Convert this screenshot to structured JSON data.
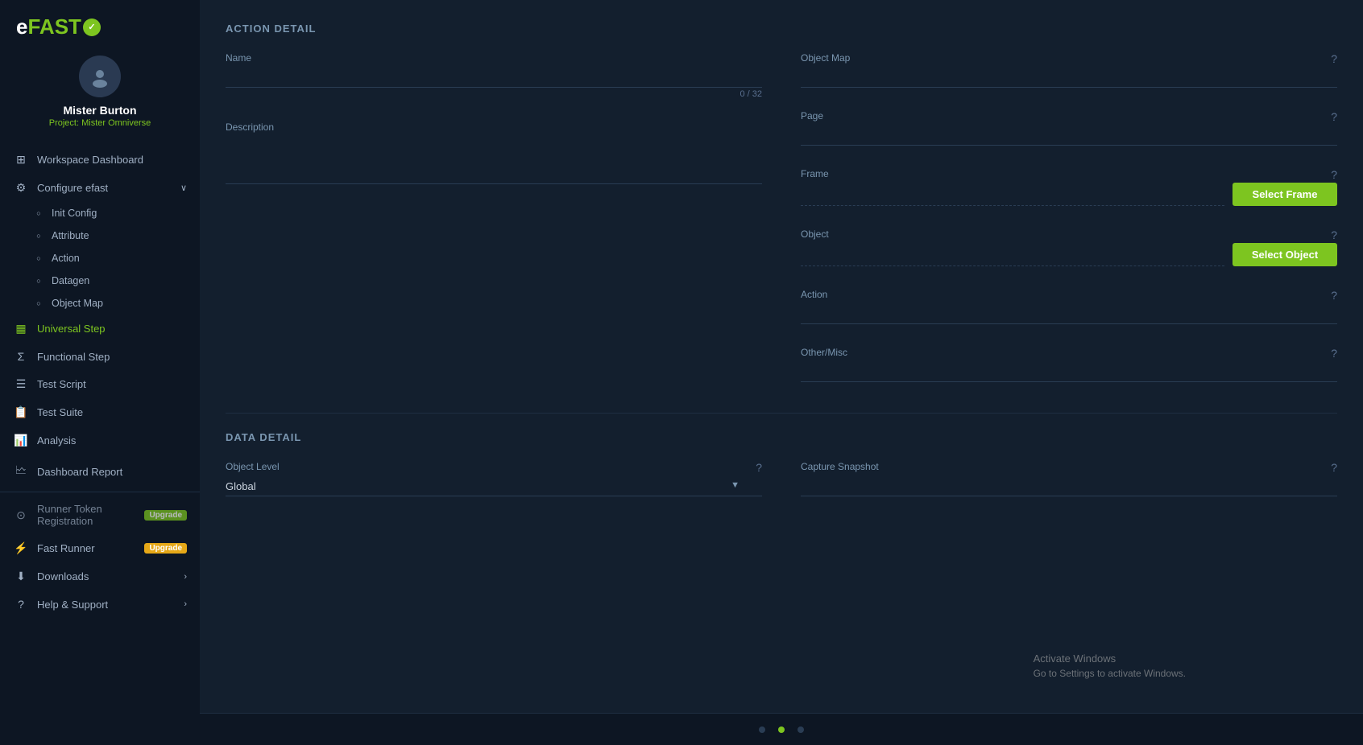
{
  "app": {
    "logo_text": "eFAST",
    "logo_symbol": "✓"
  },
  "user": {
    "name": "Mister Burton",
    "project_label": "Project: Mister Omniverse"
  },
  "sidebar": {
    "items": [
      {
        "id": "workspace-dashboard",
        "label": "Workspace Dashboard",
        "icon": "⊞",
        "active": false,
        "indent": 0
      },
      {
        "id": "configure-efast",
        "label": "Configure efast",
        "icon": "⚙",
        "active": false,
        "indent": 0,
        "has_arrow": true,
        "arrow": "∨"
      },
      {
        "id": "init-config",
        "label": "Init Config",
        "icon": "○",
        "active": false,
        "indent": 1
      },
      {
        "id": "attribute",
        "label": "Attribute",
        "icon": "○",
        "active": false,
        "indent": 1
      },
      {
        "id": "action",
        "label": "Action",
        "icon": "○",
        "active": false,
        "indent": 1
      },
      {
        "id": "datagen",
        "label": "Datagen",
        "icon": "○",
        "active": false,
        "indent": 1
      },
      {
        "id": "object-map",
        "label": "Object Map",
        "icon": "○",
        "active": false,
        "indent": 1
      },
      {
        "id": "universal-step",
        "label": "Universal Step",
        "icon": "▦",
        "active": true,
        "indent": 0
      },
      {
        "id": "functional-step",
        "label": "Functional Step",
        "icon": "Σ",
        "active": false,
        "indent": 0
      },
      {
        "id": "test-script",
        "label": "Test Script",
        "icon": "☰",
        "active": false,
        "indent": 0
      },
      {
        "id": "test-suite",
        "label": "Test Suite",
        "icon": "📋",
        "active": false,
        "indent": 0
      },
      {
        "id": "analysis",
        "label": "Analysis",
        "icon": "📊",
        "active": false,
        "indent": 0
      },
      {
        "id": "dashboard-report",
        "label": "Dashboard Report",
        "icon": "🗠",
        "active": false,
        "indent": 0
      },
      {
        "id": "runner-token",
        "label": "Runner Token Registration",
        "icon": "⊙",
        "active": false,
        "indent": 0,
        "badge": "Upgrade",
        "badge_type": "green"
      },
      {
        "id": "fast-runner",
        "label": "Fast Runner",
        "icon": "⚡",
        "active": false,
        "indent": 0,
        "badge": "Upgrade",
        "badge_type": "orange"
      },
      {
        "id": "downloads",
        "label": "Downloads",
        "icon": "⬇",
        "active": false,
        "indent": 0,
        "has_arrow": true,
        "arrow": "›"
      },
      {
        "id": "help-support",
        "label": "Help & Support",
        "icon": "?",
        "active": false,
        "indent": 0,
        "has_arrow": true,
        "arrow": "›"
      }
    ]
  },
  "main": {
    "action_detail": {
      "title": "ACTION DETAIL",
      "name_label": "Name",
      "name_placeholder": "",
      "name_char_count": "0 / 32",
      "description_label": "Description",
      "description_placeholder": "",
      "object_map_label": "Object Map",
      "page_label": "Page",
      "frame_label": "Frame",
      "frame_btn": "Select Frame",
      "object_label": "Object",
      "object_btn": "Select Object",
      "action_label": "Action",
      "other_misc_label": "Other/Misc"
    },
    "data_detail": {
      "title": "DATA DETAIL",
      "object_level_label": "Object Level",
      "object_level_value": "Global",
      "capture_snapshot_label": "Capture Snapshot"
    }
  },
  "activate_windows": {
    "line1": "Activate Windows",
    "line2": "Go to Settings to activate Windows."
  }
}
